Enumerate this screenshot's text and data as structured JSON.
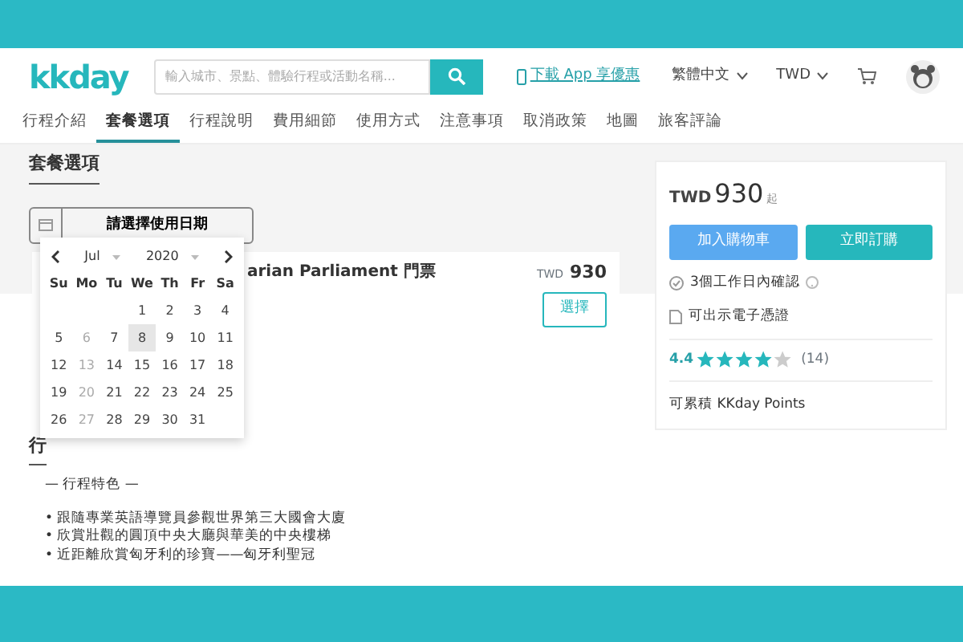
{
  "header": {
    "logo": "kkday",
    "search": {
      "placeholder": "輸入城市、景點、體驗行程或活動名稱..."
    },
    "app_link": "下載 App 享優惠",
    "language": "繁體中文",
    "currency": "TWD"
  },
  "tabs": [
    {
      "label": "行程介紹",
      "selected": false
    },
    {
      "label": "套餐選項",
      "selected": true
    },
    {
      "label": "行程說明",
      "selected": false
    },
    {
      "label": "費用細節",
      "selected": false
    },
    {
      "label": "使用方式",
      "selected": false
    },
    {
      "label": "注意事項",
      "selected": false
    },
    {
      "label": "取消政策",
      "selected": false
    },
    {
      "label": "地圖",
      "selected": false
    },
    {
      "label": "旅客評論",
      "selected": false
    }
  ],
  "section_title": "套餐選項",
  "date_picker": {
    "label": "請選擇使用日期",
    "month": "Jul",
    "year": "2020",
    "weekdays": [
      "Su",
      "Mo",
      "Tu",
      "We",
      "Th",
      "Fr",
      "Sa"
    ],
    "weeks": [
      [
        {
          "kind": "blank"
        },
        {
          "kind": "blank"
        },
        {
          "kind": "blank"
        },
        {
          "kind": "day",
          "day": "1",
          "disabled": false,
          "selected": false
        },
        {
          "kind": "day",
          "day": "2",
          "disabled": false,
          "selected": false
        },
        {
          "kind": "day",
          "day": "3",
          "disabled": false,
          "selected": false
        },
        {
          "kind": "day",
          "day": "4",
          "disabled": false,
          "selected": false
        }
      ],
      [
        {
          "day": "5",
          "disabled": false,
          "selected": false
        },
        {
          "day": "6",
          "disabled": true,
          "selected": false
        },
        {
          "day": "7",
          "disabled": false,
          "selected": false
        },
        {
          "day": "8",
          "disabled": false,
          "selected": true
        },
        {
          "day": "9",
          "disabled": false,
          "selected": false
        },
        {
          "day": "10",
          "disabled": false,
          "selected": false
        },
        {
          "day": "11",
          "disabled": false,
          "selected": false
        }
      ],
      [
        {
          "day": "12",
          "disabled": false,
          "selected": false
        },
        {
          "day": "13",
          "disabled": true,
          "selected": false
        },
        {
          "day": "14",
          "disabled": false,
          "selected": false
        },
        {
          "day": "15",
          "disabled": false,
          "selected": false
        },
        {
          "day": "16",
          "disabled": false,
          "selected": false
        },
        {
          "day": "17",
          "disabled": false,
          "selected": false
        },
        {
          "day": "18",
          "disabled": false,
          "selected": false
        }
      ],
      [
        {
          "day": "19",
          "disabled": false,
          "selected": false
        },
        {
          "day": "20",
          "disabled": true,
          "selected": false
        },
        {
          "day": "21",
          "disabled": false,
          "selected": false
        },
        {
          "day": "22",
          "disabled": false,
          "selected": false
        },
        {
          "day": "23",
          "disabled": false,
          "selected": false
        },
        {
          "day": "24",
          "disabled": false,
          "selected": false
        },
        {
          "day": "25",
          "disabled": false,
          "selected": false
        }
      ],
      [
        {
          "day": "26",
          "disabled": false,
          "selected": false
        },
        {
          "day": "27",
          "disabled": true,
          "selected": false
        },
        {
          "day": "28",
          "disabled": false,
          "selected": false
        },
        {
          "day": "29",
          "disabled": false,
          "selected": false
        },
        {
          "day": "30",
          "disabled": false,
          "selected": false
        },
        {
          "day": "31",
          "disabled": false,
          "selected": false
        },
        {
          "kind": "blank"
        }
      ]
    ]
  },
  "package": {
    "title": "arian Parliament 門票",
    "currency": "TWD",
    "price": "930",
    "button": "選擇"
  },
  "details": {
    "heading": "行",
    "subtitle": "— 行程特色 —",
    "bullets": [
      "• 跟隨專業英語導覽員參觀世界第三大國會大廈",
      "• 欣賞壯觀的圓頂中央大廳與華美的中央樓梯",
      "• 近距離欣賞匈牙利的珍寶——匈牙利聖冠"
    ]
  },
  "booking": {
    "currency": "TWD",
    "price": "930",
    "suffix": "起",
    "cart_button": "加入購物車",
    "buy_button": "立即訂購",
    "features": [
      {
        "kind": "confirm",
        "text": "3個工作日內確認"
      },
      {
        "kind": "voucher",
        "text": "可出示電子憑證"
      }
    ],
    "rating": "4.4",
    "stars": 4,
    "reviews": "(14)",
    "points": "可累積 KKday Points"
  }
}
